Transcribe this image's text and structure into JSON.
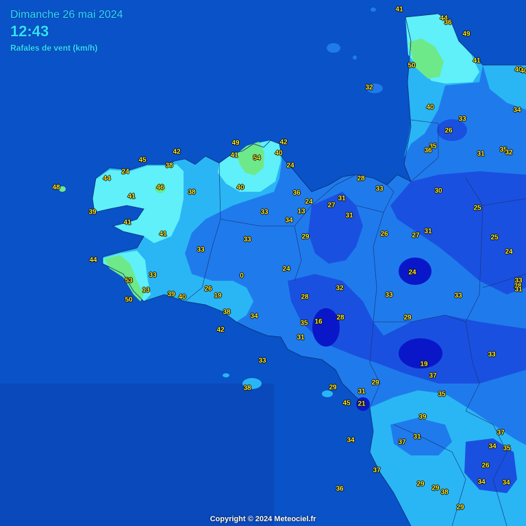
{
  "header": {
    "date": "Dimanche 26 mai 2024",
    "time": "12:43",
    "subtitle": "Rafales de vent (km/h)"
  },
  "footer": {
    "copyright": "Copyright © 2024 Meteociel.fr"
  },
  "colors": {
    "sea": "#0a52c8",
    "gust_16_24": "#0a17c8",
    "gust_25_30": "#1a50e0",
    "gust_31_35": "#1f7bec",
    "gust_36_40": "#2ab6f5",
    "gust_41_45": "#5ff0fa",
    "gust_46_plus": "#6ee98a",
    "label_text": "#ffee33"
  },
  "stations": [
    {
      "v": "41"
    },
    {
      "v": "44"
    },
    {
      "v": "36"
    },
    {
      "v": "49"
    },
    {
      "v": "50"
    },
    {
      "v": "41"
    },
    {
      "v": "40"
    },
    {
      "v": "32"
    },
    {
      "v": "40"
    },
    {
      "v": "34"
    },
    {
      "v": "33"
    },
    {
      "v": "26"
    },
    {
      "v": "35"
    },
    {
      "v": "36"
    },
    {
      "v": "31"
    },
    {
      "v": "35"
    },
    {
      "v": "32"
    },
    {
      "v": "49"
    },
    {
      "v": "42"
    },
    {
      "v": "41"
    },
    {
      "v": "54"
    },
    {
      "v": "40"
    },
    {
      "v": "24"
    },
    {
      "v": "45"
    },
    {
      "v": "42"
    },
    {
      "v": "38"
    },
    {
      "v": "24"
    },
    {
      "v": "44"
    },
    {
      "v": "48"
    },
    {
      "v": "46"
    },
    {
      "v": "38"
    },
    {
      "v": "40"
    },
    {
      "v": "36"
    },
    {
      "v": "28"
    },
    {
      "v": "33"
    },
    {
      "v": "30"
    },
    {
      "v": "41"
    },
    {
      "v": "39"
    },
    {
      "v": "41"
    },
    {
      "v": "24"
    },
    {
      "v": "31"
    },
    {
      "v": "27"
    },
    {
      "v": "13"
    },
    {
      "v": "33"
    },
    {
      "v": "34"
    },
    {
      "v": "31"
    },
    {
      "v": "25"
    },
    {
      "v": "41"
    },
    {
      "v": "33"
    },
    {
      "v": "29"
    },
    {
      "v": "26"
    },
    {
      "v": "27"
    },
    {
      "v": "31"
    },
    {
      "v": "25"
    },
    {
      "v": "33"
    },
    {
      "v": "24"
    },
    {
      "v": "44"
    },
    {
      "v": "33"
    },
    {
      "v": "0"
    },
    {
      "v": "24"
    },
    {
      "v": "24"
    },
    {
      "v": "53"
    },
    {
      "v": "33"
    },
    {
      "v": "32"
    },
    {
      "v": "33"
    },
    {
      "v": "13"
    },
    {
      "v": "39"
    },
    {
      "v": "40"
    },
    {
      "v": "26"
    },
    {
      "v": "28"
    },
    {
      "v": "50"
    },
    {
      "v": "19"
    },
    {
      "v": "33"
    },
    {
      "v": "31"
    },
    {
      "v": "28"
    },
    {
      "v": "38"
    },
    {
      "v": "34"
    },
    {
      "v": "16"
    },
    {
      "v": "28"
    },
    {
      "v": "29"
    },
    {
      "v": "35"
    },
    {
      "v": "42"
    },
    {
      "v": "31"
    },
    {
      "v": "19"
    },
    {
      "v": "33"
    },
    {
      "v": "33"
    },
    {
      "v": "37"
    },
    {
      "v": "29"
    },
    {
      "v": "38"
    },
    {
      "v": "29"
    },
    {
      "v": "31"
    },
    {
      "v": "35"
    },
    {
      "v": "45"
    },
    {
      "v": "21"
    },
    {
      "v": "39"
    },
    {
      "v": "34"
    },
    {
      "v": "37"
    },
    {
      "v": "31"
    },
    {
      "v": "37"
    },
    {
      "v": "34"
    },
    {
      "v": "35"
    },
    {
      "v": "37"
    },
    {
      "v": "26"
    },
    {
      "v": "29"
    },
    {
      "v": "29"
    },
    {
      "v": "38"
    },
    {
      "v": "34"
    },
    {
      "v": "34"
    },
    {
      "v": "36"
    },
    {
      "v": "29"
    },
    {
      "v": "40"
    }
  ]
}
